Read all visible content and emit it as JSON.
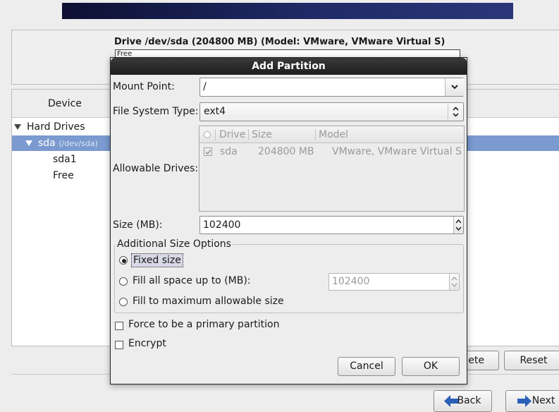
{
  "drive": {
    "title": "Drive /dev/sda (204800 MB) (Model: VMware, VMware Virtual S)",
    "free_label": "Free"
  },
  "tree": {
    "header": "Device",
    "hard_drives": "Hard Drives",
    "sda_label": "sda",
    "sda_path": "(/dev/sda)",
    "sda1": "sda1",
    "free": "Free"
  },
  "buttons": {
    "delete": "lete",
    "reset": "Reset",
    "back": "Back",
    "next": "Next"
  },
  "dialog": {
    "title": "Add Partition",
    "mount_point_label": "Mount Point:",
    "mount_point_value": "/",
    "fs_type_label": "File System Type:",
    "fs_type_value": "ext4",
    "allowable_drives_label": "Allowable Drives:",
    "drives_columns": [
      "Drive",
      "Size",
      "Model"
    ],
    "drives_rows": [
      {
        "checked": true,
        "drive": "sda",
        "size": "204800 MB",
        "model": "VMware, VMware Virtual S"
      }
    ],
    "size_label": "Size (MB):",
    "size_value": "102400",
    "size_options_title": "Additional Size Options",
    "opt_fixed": "Fixed size",
    "opt_fill_up_to": "Fill all space up to (MB):",
    "fill_up_to_value": "102400",
    "opt_fill_max": "Fill to maximum allowable size",
    "selected_option": "Fixed size",
    "force_primary": "Force to be a primary partition",
    "force_primary_checked": false,
    "encrypt": "Encrypt",
    "encrypt_checked": false,
    "cancel": "Cancel",
    "ok": "OK"
  },
  "colors": {
    "banner": "#1f2a66",
    "selection": "#7a9ad0",
    "dialog_title_bg": "#1e1e1e"
  }
}
